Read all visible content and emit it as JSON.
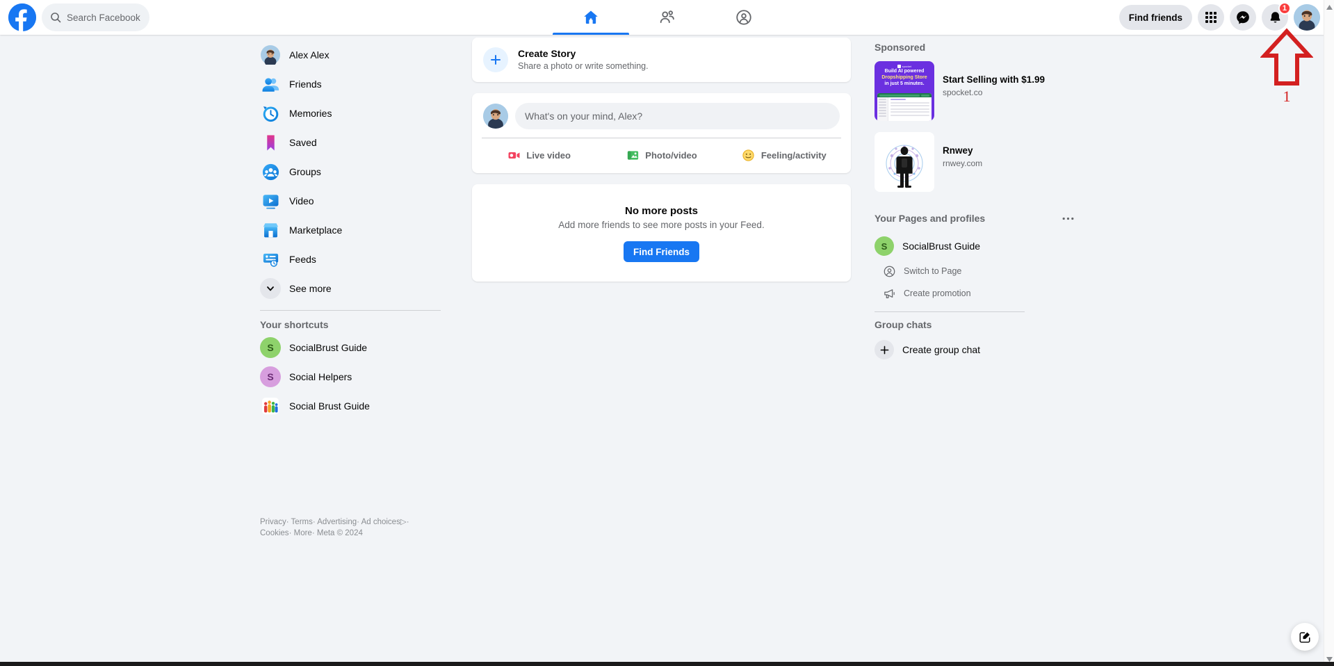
{
  "topbar": {
    "logo_icon": "facebook-logo-icon",
    "search": {
      "icon": "search-icon",
      "placeholder": "Search Facebook",
      "value": ""
    },
    "tabs": [
      {
        "id": "home",
        "icon": "home-icon",
        "label": "Home",
        "active": true
      },
      {
        "id": "friends",
        "icon": "friends-icon",
        "label": "Friends",
        "active": false
      },
      {
        "id": "groups",
        "icon": "groups-icon",
        "label": "Groups",
        "active": false
      }
    ],
    "find_friends_label": "Find friends",
    "menu_icon": "grid-menu-icon",
    "messenger_icon": "messenger-icon",
    "notifications_icon": "bell-icon",
    "notifications_count": "1",
    "account_icon": "account-avatar"
  },
  "sidebar": {
    "items": [
      {
        "label": "Alex Alex",
        "icon": "profile-avatar-icon"
      },
      {
        "label": "Friends",
        "icon": "friends-icon"
      },
      {
        "label": "Memories",
        "icon": "memories-clock-icon"
      },
      {
        "label": "Saved",
        "icon": "saved-bookmark-icon"
      },
      {
        "label": "Groups",
        "icon": "groups-icon"
      },
      {
        "label": "Video",
        "icon": "video-play-icon"
      },
      {
        "label": "Marketplace",
        "icon": "marketplace-store-icon"
      },
      {
        "label": "Feeds",
        "icon": "feeds-icon"
      }
    ],
    "see_more": {
      "label": "See more",
      "icon": "chevron-down-icon"
    },
    "shortcuts_title": "Your shortcuts",
    "shortcuts": [
      {
        "label": "SocialBrust Guide",
        "initial": "S",
        "color": "#8ed26b",
        "text_color": "#2e5c1a"
      },
      {
        "label": "Social Helpers",
        "initial": "S",
        "color": "#d79ede",
        "text_color": "#6b2b74"
      },
      {
        "label": "Social Brust Guide",
        "initial": "",
        "color": "#ffffff",
        "text_color": "#000000"
      }
    ]
  },
  "feed": {
    "create_story": {
      "icon": "plus-icon",
      "title": "Create Story",
      "subtitle": "Share a photo or write something."
    },
    "composer": {
      "avatar_icon": "profile-avatar-icon",
      "placeholder": "What's on your mind, Alex?",
      "value": "",
      "actions": [
        {
          "label": "Live video",
          "icon": "live-video-icon",
          "color": "#f3425f"
        },
        {
          "label": "Photo/video",
          "icon": "photo-video-icon",
          "color": "#45bd62"
        },
        {
          "label": "Feeling/activity",
          "icon": "feeling-activity-icon",
          "color": "#f7b928"
        }
      ]
    },
    "empty_state": {
      "title": "No more posts",
      "subtitle": "Add more friends to see more posts in your Feed.",
      "button_label": "Find Friends"
    }
  },
  "rightbar": {
    "sponsored_title": "Sponsored",
    "ads": [
      {
        "title": "Start Selling with $1.99",
        "url": "spocket.co",
        "image_name": "spocket-dropshipping-ad-image",
        "image_lines": [
          "Build AI powered",
          "Dropshipping Store",
          "in just 5 minutes."
        ],
        "image_brand": "spocket",
        "image_bg": "#6b30e0"
      },
      {
        "title": "Rnwey",
        "url": "rnwey.com",
        "image_name": "rnwey-person-ad-image",
        "image_lines": [],
        "image_brand": "",
        "image_bg": "#ffffff"
      }
    ],
    "pages_title": "Your Pages and profiles",
    "pages_menu_icon": "ellipsis-icon",
    "page": {
      "name": "SocialBrust Guide",
      "initial": "S",
      "color": "#8ed26b",
      "actions": [
        {
          "label": "Switch to Page",
          "icon": "switch-profile-icon"
        },
        {
          "label": "Create promotion",
          "icon": "megaphone-icon"
        }
      ]
    },
    "group_chats_title": "Group chats",
    "create_group_chat": {
      "label": "Create group chat",
      "icon": "plus-icon"
    }
  },
  "footer": {
    "links": [
      "Privacy",
      "Terms",
      "Advertising",
      "Ad choices",
      "Cookies",
      "More"
    ],
    "ad_choices_icon": "ad-choices-icon",
    "copyright": "Meta © 2024",
    "separator": "·"
  },
  "compose_fab": {
    "icon": "compose-pencil-icon"
  },
  "annotation": {
    "marker_icon": "red-up-arrow-icon",
    "number": "1",
    "color": "#d32020"
  },
  "scrollbar": {
    "up_icon": "scroll-up-arrow-icon",
    "down_icon": "scroll-down-arrow-icon"
  }
}
